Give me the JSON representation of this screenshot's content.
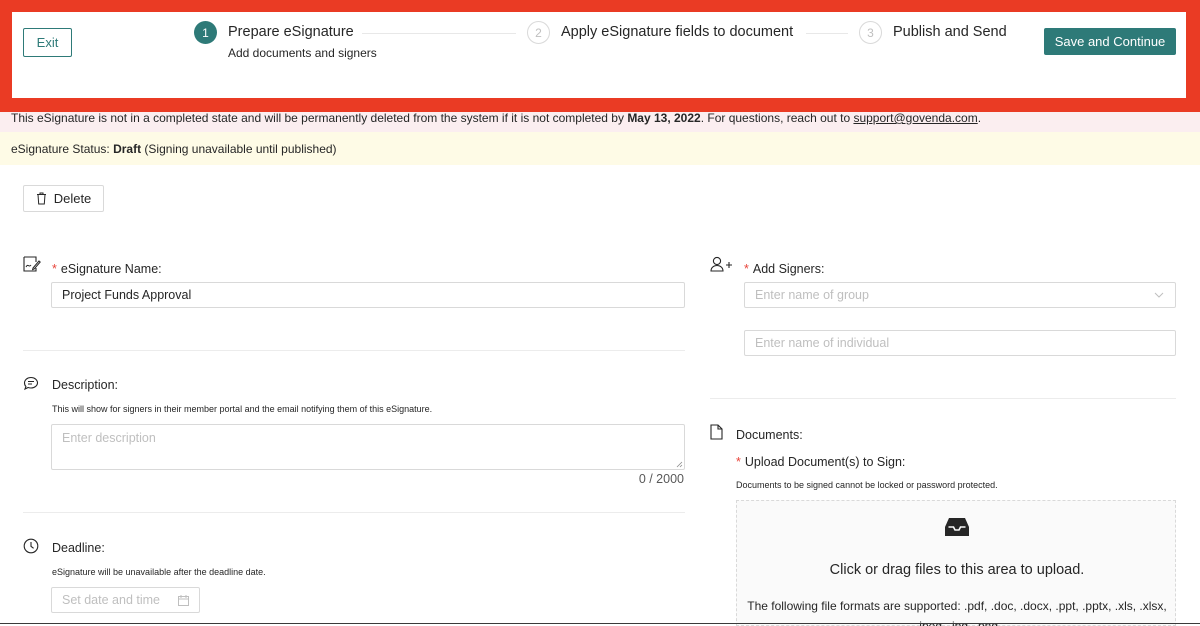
{
  "header": {
    "exit_label": "Exit",
    "steps": [
      {
        "number": "1",
        "title": "Prepare eSignature",
        "subtitle": "Add documents and signers"
      },
      {
        "number": "2",
        "title": "Apply eSignature fields to document"
      },
      {
        "number": "3",
        "title": "Publish and Send"
      }
    ],
    "save_label": "Save and Continue"
  },
  "notice": {
    "text_before": "This eSignature is not in a completed state and will be permanently deleted from the system if it is not completed by ",
    "date": "May 13, 2022",
    "text_middle": ". For questions, reach out to ",
    "email": "support@govenda.com",
    "text_after": "."
  },
  "status": {
    "prefix": "eSignature Status: ",
    "value": "Draft",
    "suffix": " (Signing unavailable until published)"
  },
  "delete_label": "Delete",
  "name_field": {
    "label": "eSignature Name",
    "value": "Project Funds Approval"
  },
  "signers": {
    "label": "Add Signers",
    "group_placeholder": "Enter name of group",
    "individual_placeholder": "Enter name of individual"
  },
  "description": {
    "label": "Description",
    "help": "This will show for signers in their member portal and the email notifying them of this eSignature.",
    "placeholder": "Enter description",
    "counter": "0 / 2000"
  },
  "documents": {
    "label": "Documents",
    "upload_label": "Upload Document(s) to Sign",
    "help": "Documents to be signed cannot be locked or password protected.",
    "upload_title": "Click or drag files to this area to upload.",
    "upload_formats": "The following file formats are supported: .pdf, .doc, .docx, .ppt, .pptx, .xls, .xlsx, .jpeg, .jpg, .png"
  },
  "deadline": {
    "label": "Deadline",
    "help": "eSignature will be unavailable after the deadline date.",
    "placeholder": "Set date and time"
  },
  "colors": {
    "accent": "#2e7a78",
    "highlight_border": "#ea3b24",
    "notice_bg": "#fbeef0",
    "status_bg": "#fefbe6",
    "required": "#e8443a"
  }
}
